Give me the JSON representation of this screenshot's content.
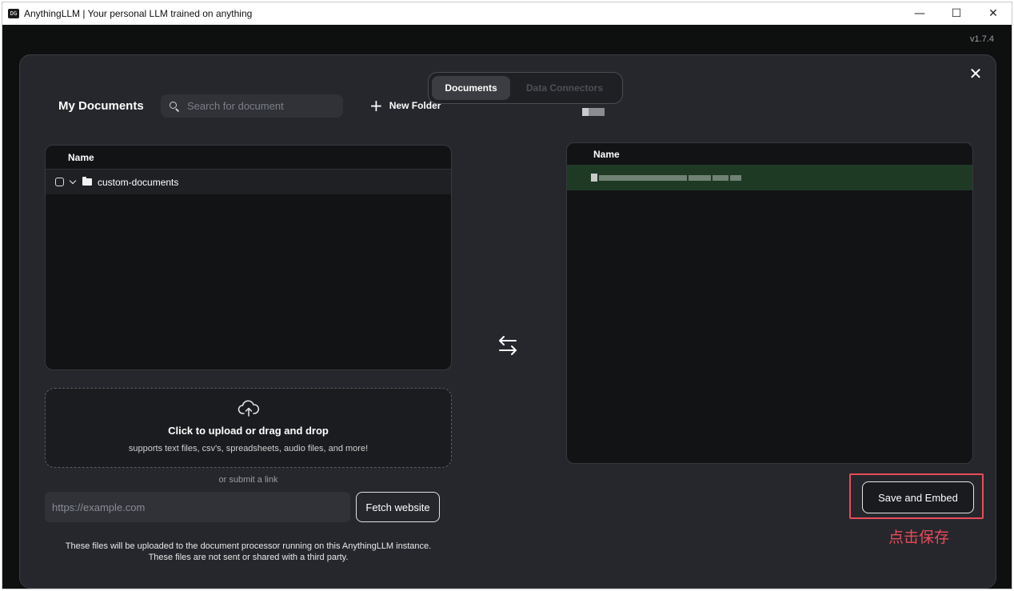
{
  "window": {
    "app_icon": "DG",
    "title": "AnythingLLM | Your personal LLM trained on anything",
    "controls": {
      "minimize": "—",
      "maximize": "☐",
      "close": "✕"
    }
  },
  "version": "v1.7.4",
  "tabs": [
    {
      "label": "Documents",
      "active": true
    },
    {
      "label": "Data Connectors",
      "active": false
    }
  ],
  "left_panel": {
    "title": "My Documents",
    "search_placeholder": "Search for document",
    "new_folder_label": "New Folder",
    "column_header": "Name",
    "folders": [
      {
        "name": "custom-documents"
      }
    ],
    "upload": {
      "title": "Click to upload or drag and drop",
      "subtitle": "supports text files, csv's, spreadsheets, audio files, and more!"
    },
    "or_link": "or submit a link",
    "url_placeholder": "https://example.com",
    "fetch_label": "Fetch website",
    "footer_line1": "These files will be uploaded to the document processor running on this AnythingLLM instance.",
    "footer_line2": "These files are not sent or shared with a third party."
  },
  "right_panel": {
    "column_header": "Name"
  },
  "save_button_label": "Save and Embed",
  "annotation_text": "点击保存",
  "colors": {
    "highlight": "#e94b5a",
    "selected_row": "#1e3a25",
    "modal_bg": "#25272c"
  },
  "icons": [
    "search-icon",
    "plus-icon",
    "chevron-down-icon",
    "folder-icon",
    "cloud-upload-icon",
    "transfer-arrows-icon",
    "close-icon"
  ]
}
